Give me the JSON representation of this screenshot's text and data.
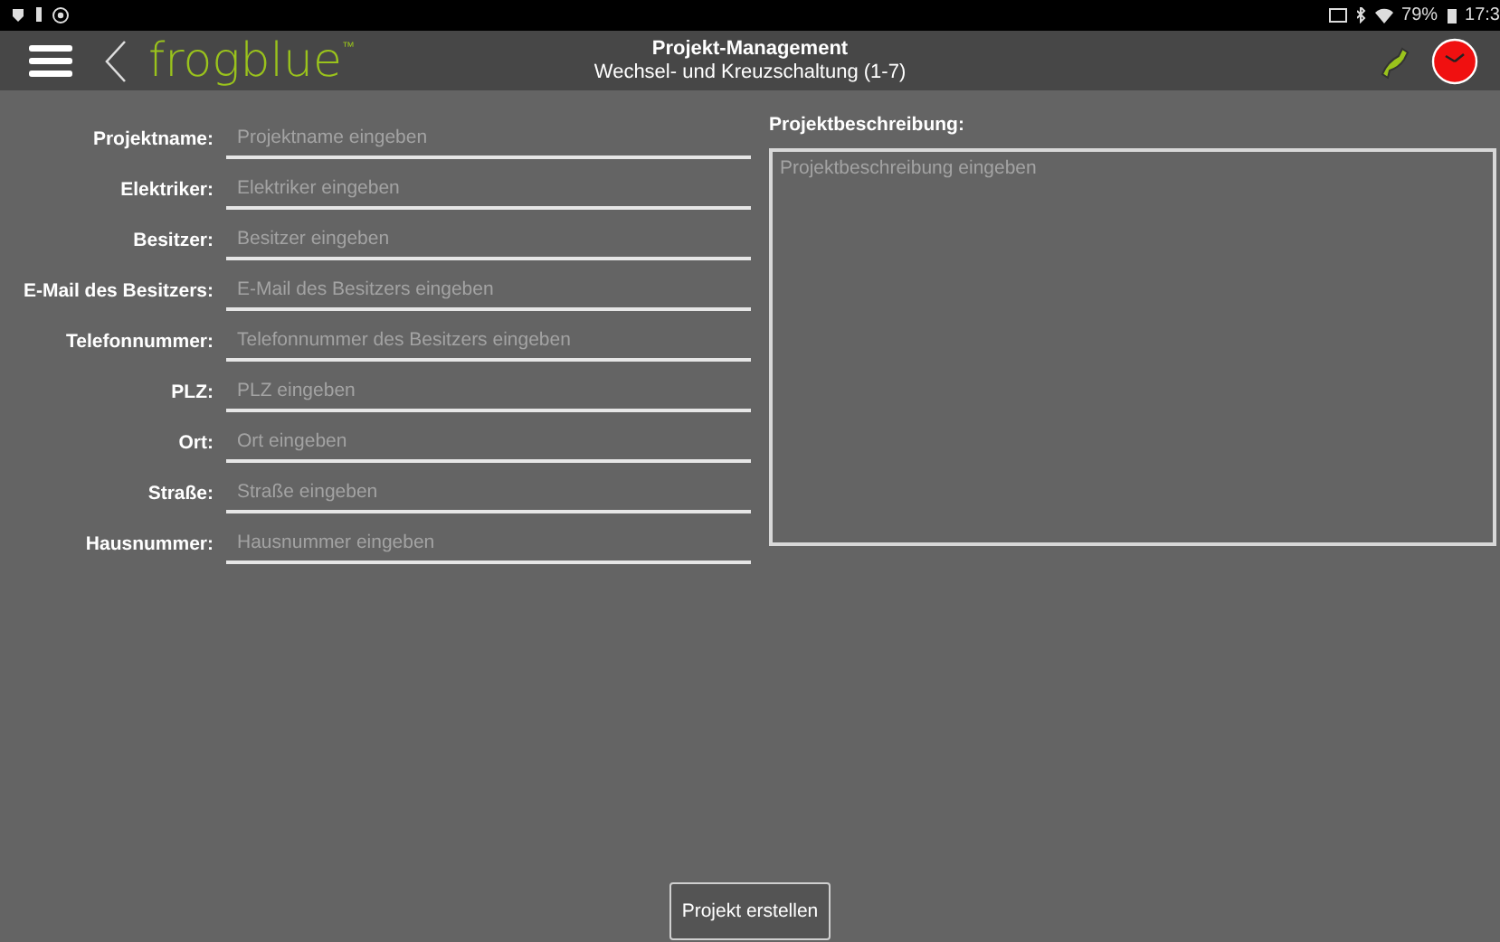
{
  "status_bar": {
    "battery": "79%",
    "time": "17:3"
  },
  "header": {
    "logo": "frogblue",
    "trademark": "™",
    "title": "Projekt-Management",
    "subtitle": "Wechsel- und Kreuzschaltung (1-7)"
  },
  "fields": [
    {
      "label": "Projektname:",
      "placeholder": "Projektname eingeben"
    },
    {
      "label": "Elektriker:",
      "placeholder": "Elektriker eingeben"
    },
    {
      "label": "Besitzer:",
      "placeholder": "Besitzer eingeben"
    },
    {
      "label": "E-Mail des Besitzers:",
      "placeholder": "E-Mail des Besitzers eingeben"
    },
    {
      "label": "Telefonnummer:",
      "placeholder": "Telefonnummer des Besitzers eingeben"
    },
    {
      "label": "PLZ:",
      "placeholder": "PLZ eingeben"
    },
    {
      "label": "Ort:",
      "placeholder": "Ort eingeben"
    },
    {
      "label": "Straße:",
      "placeholder": "Straße eingeben"
    },
    {
      "label": "Hausnummer:",
      "placeholder": "Hausnummer eingeben"
    }
  ],
  "description": {
    "label": "Projektbeschreibung:",
    "placeholder": "Projektbeschreibung eingeben"
  },
  "button": "Projekt erstellen"
}
